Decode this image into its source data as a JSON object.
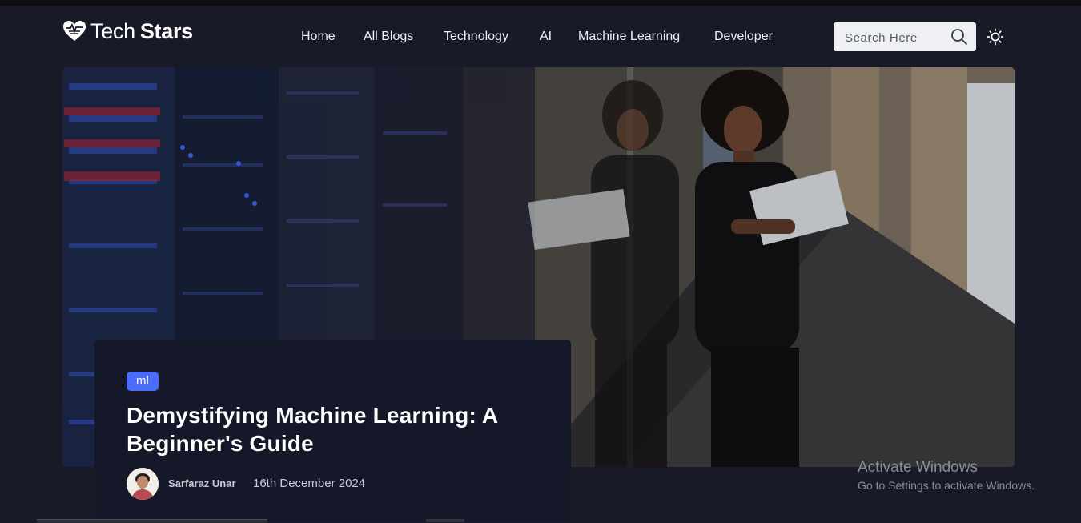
{
  "brand": {
    "name_part1": "Tech",
    "name_part2": "Stars"
  },
  "nav": {
    "items": [
      {
        "label": "Home"
      },
      {
        "label": "All Blogs"
      },
      {
        "label": "Technology"
      },
      {
        "label": "AI"
      },
      {
        "label": "Machine Learning"
      },
      {
        "label": "Developer"
      }
    ]
  },
  "search": {
    "placeholder": "Search Here",
    "value": ""
  },
  "icons": {
    "logo": "heart-logo-icon",
    "search": "search-icon",
    "theme": "sun-icon"
  },
  "featured_post": {
    "tag": "ml",
    "title": "Demystifying Machine Learning: A Beginner's Guide",
    "author": "Sarfaraz Unar",
    "date": "16th December 2024"
  },
  "os_overlay": {
    "line1": "Activate Windows",
    "line2": "Go to Settings to activate Windows."
  },
  "colors": {
    "background": "#181a28",
    "card": "#141829",
    "tag": "#4b6bfb",
    "search_box": "#eef0f4"
  }
}
